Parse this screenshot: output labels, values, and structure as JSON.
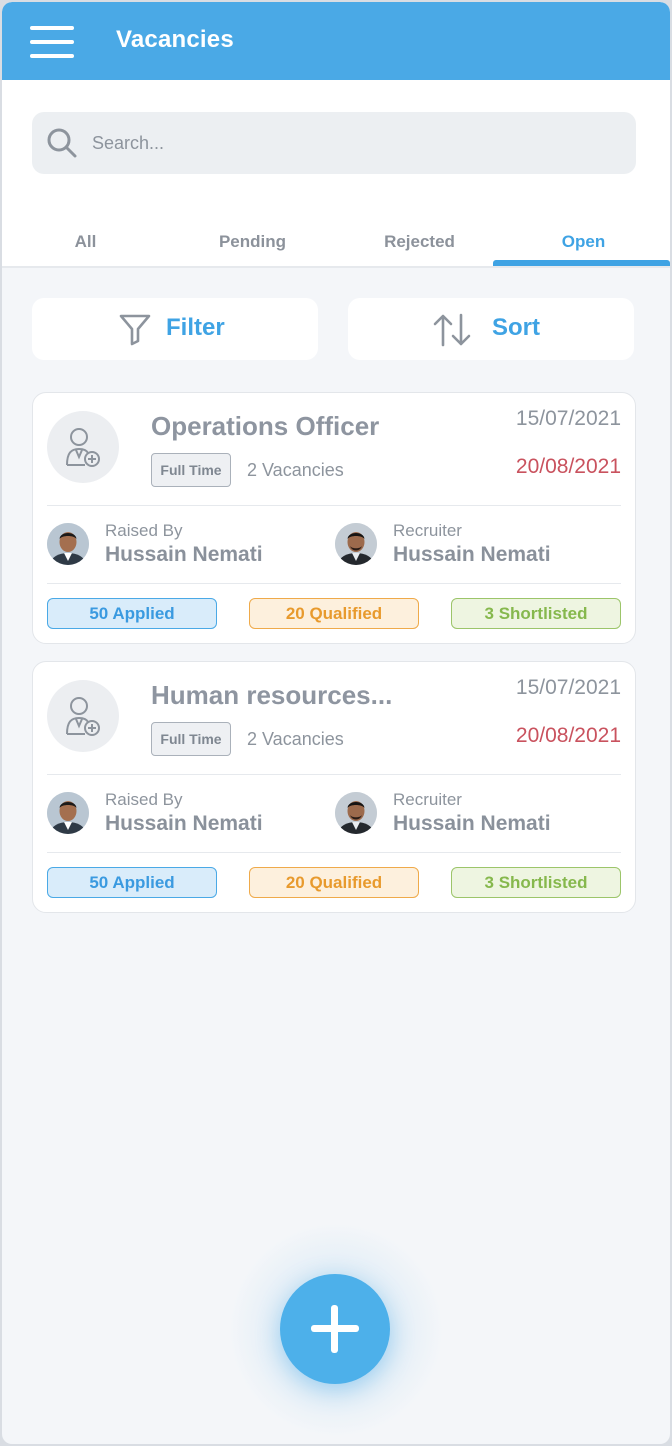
{
  "appbar": {
    "title": "Vacancies"
  },
  "search": {
    "placeholder": "Search..."
  },
  "tabs": [
    {
      "label": "All",
      "active": false
    },
    {
      "label": "Pending",
      "active": false
    },
    {
      "label": "Rejected",
      "active": false
    },
    {
      "label": "Open",
      "active": true
    }
  ],
  "actions": {
    "filter_label": "Filter",
    "sort_label": "Sort"
  },
  "vacancies": [
    {
      "title": "Operations Officer",
      "type": "Full Time",
      "vacancy_count": "2 Vacancies",
      "date_start": "15/07/2021",
      "date_end": "20/08/2021",
      "raised_by": {
        "role": "Raised By",
        "name": "Hussain Nemati"
      },
      "recruiter": {
        "role": "Recruiter",
        "name": "Hussain Nemati"
      },
      "stats": {
        "applied": "50 Applied",
        "qualified": "20 Qualified",
        "shortlisted": "3 Shortlisted"
      }
    },
    {
      "title": "Human resources...",
      "type": "Full Time",
      "vacancy_count": "2 Vacancies",
      "date_start": "15/07/2021",
      "date_end": "20/08/2021",
      "raised_by": {
        "role": "Raised By",
        "name": "Hussain Nemati"
      },
      "recruiter": {
        "role": "Recruiter",
        "name": "Hussain Nemati"
      },
      "stats": {
        "applied": "50 Applied",
        "qualified": "20 Qualified",
        "shortlisted": "3 Shortlisted"
      }
    }
  ],
  "colors": {
    "primary": "#4aa9e6",
    "end_date": "#c9525e",
    "applied": "#3a9ae0",
    "qualified": "#e89a2d",
    "shortlisted": "#86b84d"
  },
  "icons": {
    "menu": "menu-icon",
    "search": "search-icon",
    "filter": "filter-icon",
    "sort": "sort-icon",
    "job": "user-add-icon",
    "fab": "plus-icon"
  }
}
